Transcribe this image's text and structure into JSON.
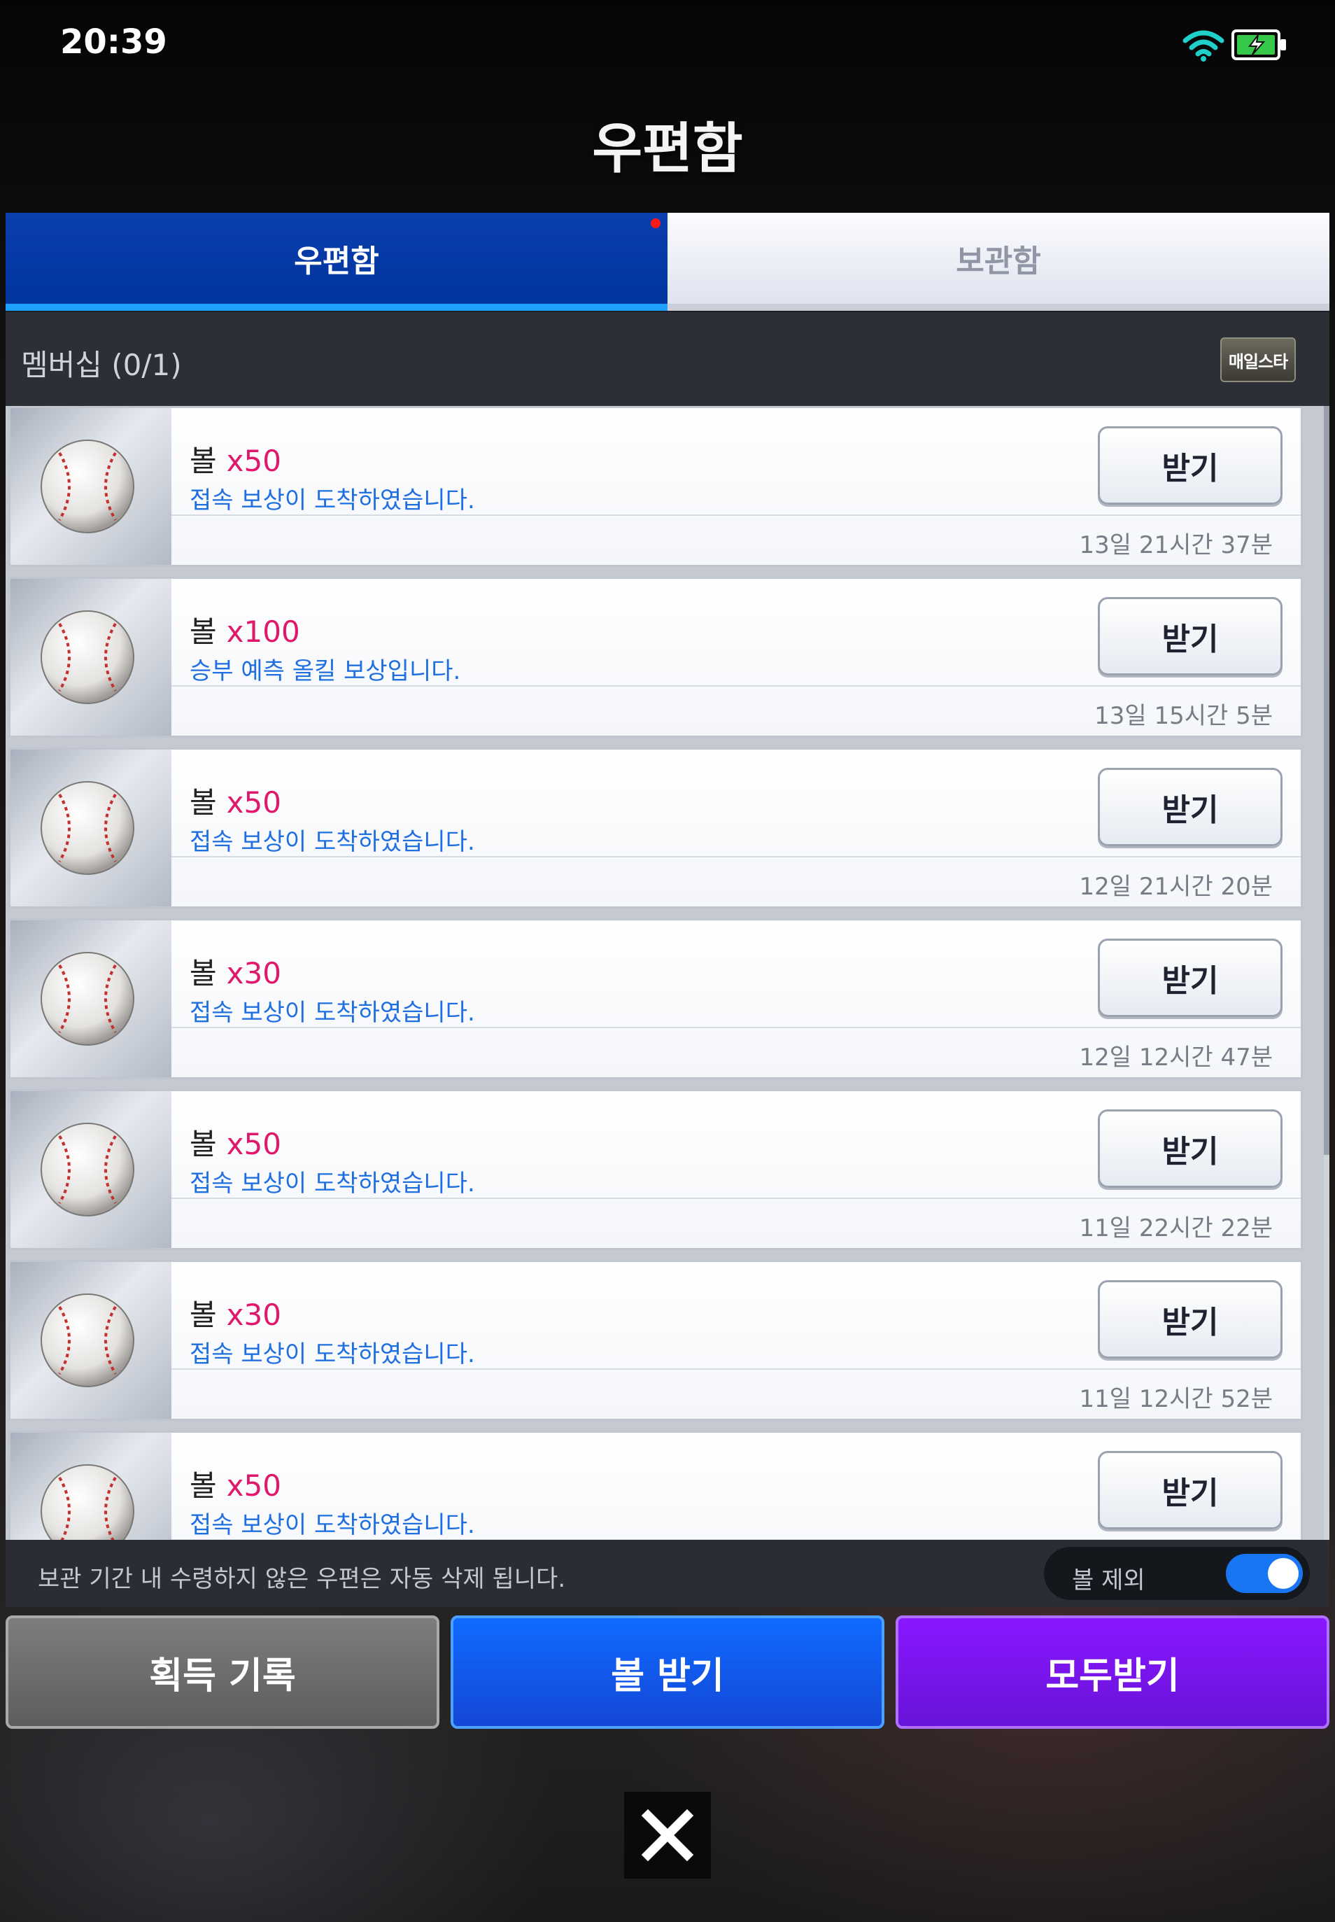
{
  "status_bar": {
    "time": "20:39"
  },
  "title": "우편함",
  "tabs": [
    {
      "label": "우편함",
      "active": true
    },
    {
      "label": "보관함",
      "active": false
    }
  ],
  "membership": {
    "label": "멤버십 (0/1)",
    "badge": "매일스타"
  },
  "mail_items": [
    {
      "name": "볼",
      "qty": "x50",
      "desc": "접속 보상이 도착하였습니다.",
      "time": "13일 21시간 37분",
      "button": "받기"
    },
    {
      "name": "볼",
      "qty": "x100",
      "desc": "승부 예측 올킬 보상입니다.",
      "time": "13일 15시간 5분",
      "button": "받기"
    },
    {
      "name": "볼",
      "qty": "x50",
      "desc": "접속 보상이 도착하였습니다.",
      "time": "12일 21시간 20분",
      "button": "받기"
    },
    {
      "name": "볼",
      "qty": "x30",
      "desc": "접속 보상이 도착하였습니다.",
      "time": "12일 12시간 47분",
      "button": "받기"
    },
    {
      "name": "볼",
      "qty": "x50",
      "desc": "접속 보상이 도착하였습니다.",
      "time": "11일 22시간 22분",
      "button": "받기"
    },
    {
      "name": "볼",
      "qty": "x30",
      "desc": "접속 보상이 도착하였습니다.",
      "time": "11일 12시간 52분",
      "button": "받기"
    },
    {
      "name": "볼",
      "qty": "x50",
      "desc": "접속 보상이 도착하였습니다.",
      "time": "",
      "button": "받기"
    }
  ],
  "notice": {
    "text": "보관 기간 내 수령하지 않은 우편은 자동 삭제 됩니다.",
    "toggle_label": "볼 제외",
    "toggle_on": true
  },
  "actions": {
    "history": "획득 기록",
    "receive_ball": "볼 받기",
    "receive_all": "모두받기"
  },
  "colors": {
    "tab_active": "#00359e",
    "qty": "#e0186c",
    "desc": "#1f6fe0",
    "ball_button": "#1447d6",
    "all_button": "#6714d8"
  }
}
